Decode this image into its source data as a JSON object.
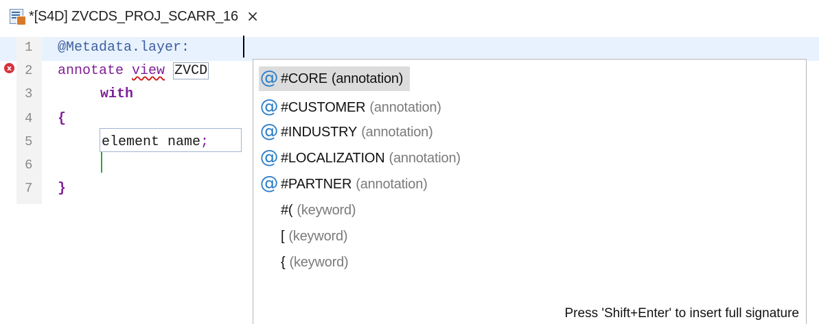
{
  "tab": {
    "title": "*[S4D] ZVCDS_PROJ_SCARR_16",
    "close": "×"
  },
  "editor": {
    "line_numbers": [
      "1",
      "2",
      "3",
      "4",
      "5",
      "6",
      "7"
    ],
    "lines": {
      "l1": "@Metadata.layer:",
      "l2_kw": "annotate",
      "l2_view": "view",
      "l2_ident": "ZVCD",
      "l3": "with",
      "l4": "{",
      "l5_elem": "element name",
      "l5_semi": ";",
      "l7": "}"
    },
    "error_marker": "x"
  },
  "completion": {
    "items": [
      {
        "icon": "at-icon",
        "label": "#CORE",
        "type": "(annotation)",
        "selected": true
      },
      {
        "icon": "at-icon",
        "label": "#CUSTOMER",
        "type": "(annotation)"
      },
      {
        "icon": "at-icon",
        "label": "#INDUSTRY",
        "type": "(annotation)"
      },
      {
        "icon": "at-icon",
        "label": "#LOCALIZATION",
        "type": "(annotation)"
      },
      {
        "icon": "at-icon",
        "label": "#PARTNER",
        "type": "(annotation)"
      },
      {
        "icon": "",
        "label": "#(",
        "type": "(keyword)"
      },
      {
        "icon": "",
        "label": "[",
        "type": "(keyword)"
      },
      {
        "icon": "",
        "label": "{",
        "type": "(keyword)"
      }
    ],
    "hint": "Press 'Shift+Enter' to insert full signature"
  },
  "colors": {
    "accent": "#2e7fc9",
    "error": "#d8303a",
    "keyword": "#7f1e96",
    "selection": "#dcdcdc"
  }
}
